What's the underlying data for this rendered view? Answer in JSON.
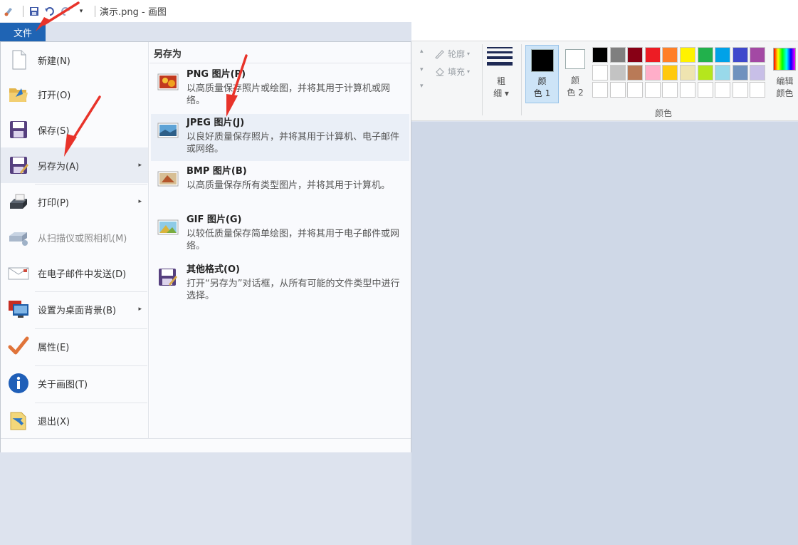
{
  "titlebar": {
    "title": "演示.png - 画图"
  },
  "file_tab": {
    "label": "文件"
  },
  "ribbon": {
    "outline_label": "轮廓",
    "fill_label": "填充",
    "size_label_1": "粗",
    "size_label_2": "细",
    "color1_label_1": "颜",
    "color1_label_2": "色 1",
    "color2_label_1": "颜",
    "color2_label_2": "色 2",
    "edit_colors_1": "编辑",
    "edit_colors_2": "颜色",
    "colors_group_label": "颜色",
    "palette": [
      "#000000",
      "#7f7f7f",
      "#880015",
      "#ed1c24",
      "#ff7f27",
      "#fff200",
      "#22b14c",
      "#00a2e8",
      "#3f48cc",
      "#a349a4",
      "#ffffff",
      "#c3c3c3",
      "#b97a57",
      "#ffaec9",
      "#ffc90e",
      "#efe4b0",
      "#b5e61d",
      "#99d9ea",
      "#7092be",
      "#c8bfe7",
      "#ffffff",
      "#ffffff",
      "#ffffff",
      "#ffffff",
      "#ffffff",
      "#ffffff",
      "#ffffff",
      "#ffffff",
      "#ffffff",
      "#ffffff"
    ]
  },
  "file_menu": {
    "items": [
      {
        "label": "新建(N)",
        "icon": "new-file-icon"
      },
      {
        "label": "打开(O)",
        "icon": "open-folder-icon"
      },
      {
        "label": "保存(S)",
        "icon": "save-disk-icon"
      },
      {
        "label": "另存为(A)",
        "icon": "save-as-icon",
        "has_submenu": true
      },
      {
        "label": "打印(P)",
        "icon": "printer-icon",
        "has_submenu": true
      },
      {
        "label": "从扫描仪或照相机(M)",
        "icon": "scanner-icon",
        "disabled": true
      },
      {
        "label": "在电子邮件中发送(D)",
        "icon": "email-icon"
      },
      {
        "label": "设置为桌面背景(B)",
        "icon": "desktop-background-icon",
        "has_submenu": true
      },
      {
        "label": "属性(E)",
        "icon": "checkmark-icon"
      },
      {
        "label": "关于画图(T)",
        "icon": "info-icon"
      },
      {
        "label": "退出(X)",
        "icon": "exit-icon"
      }
    ]
  },
  "save_as_submenu": {
    "header": "另存为",
    "items": [
      {
        "title": "PNG 图片(P)",
        "desc": "以高质量保存照片或绘图，并将其用于计算机或网络。",
        "icon": "png-image-icon"
      },
      {
        "title": "JPEG 图片(J)",
        "desc": "以良好质量保存照片，并将其用于计算机、电子邮件或网络。",
        "icon": "jpeg-image-icon"
      },
      {
        "title": "BMP 图片(B)",
        "desc": "以高质量保存所有类型图片，并将其用于计算机。",
        "icon": "bmp-image-icon"
      },
      {
        "title": "GIF 图片(G)",
        "desc": "以较低质量保存简单绘图，并将其用于电子邮件或网络。",
        "icon": "gif-image-icon"
      },
      {
        "title": "其他格式(O)",
        "desc": "打开“另存为”对话框，从所有可能的文件类型中进行选择。",
        "icon": "other-formats-icon"
      }
    ]
  }
}
